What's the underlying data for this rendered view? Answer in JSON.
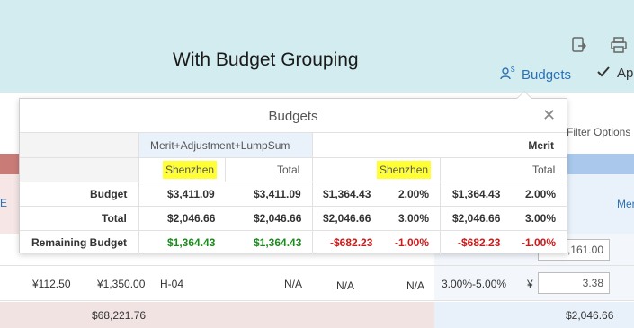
{
  "page": {
    "title": "With Budget Grouping"
  },
  "toolbar": {
    "budgets_label": "Budgets",
    "approve_label_partial": "Ap"
  },
  "background": {
    "filter_label_partial": "Filter Options",
    "mer_partial": "Mer",
    "e_partial": "E",
    "row1": {
      "input_partial": "1,161.00"
    },
    "row2": {
      "amount1": "¥112.50",
      "amount2": "¥1,350.00",
      "grade": "H-04",
      "na1": "N/A",
      "na2": "N/A",
      "na3": "N/A",
      "range": "3.00%-5.00%",
      "currency": "¥",
      "input_value": "3.38"
    },
    "totals": {
      "left_total": "$68,221.76",
      "right_total": "$2,046.66"
    }
  },
  "popover": {
    "title": "Budgets",
    "groups": [
      "Merit+Adjustment+LumpSum",
      "Merit"
    ],
    "subheaders": {
      "g1_location": "Shenzhen",
      "g1_total": "Total",
      "g2_location": "Shenzhen",
      "g2_total": "Total"
    },
    "rows": [
      {
        "label": "Budget",
        "g1_loc": "$3,411.09",
        "g1_total": "$3,411.09",
        "g2_loc_amt": "$1,364.43",
        "g2_loc_pct": "2.00%",
        "g2_total_amt": "$1,364.43",
        "g2_total_pct": "2.00%"
      },
      {
        "label": "Total",
        "g1_loc": "$2,046.66",
        "g1_total": "$2,046.66",
        "g2_loc_amt": "$2,046.66",
        "g2_loc_pct": "3.00%",
        "g2_total_amt": "$2,046.66",
        "g2_total_pct": "3.00%"
      },
      {
        "label": "Remaining Budget",
        "g1_loc": "$1,364.43",
        "g1_total": "$1,364.43",
        "g2_loc_amt": "-$682.23",
        "g2_loc_pct": "-1.00%",
        "g2_total_amt": "-$682.23",
        "g2_total_pct": "-1.00%"
      }
    ]
  },
  "colors": {
    "header_bg": "#d3ecef",
    "link": "#2a72b5",
    "positive": "#1d8a1d",
    "negative": "#cc1a1a",
    "highlight": "#ffff33"
  }
}
